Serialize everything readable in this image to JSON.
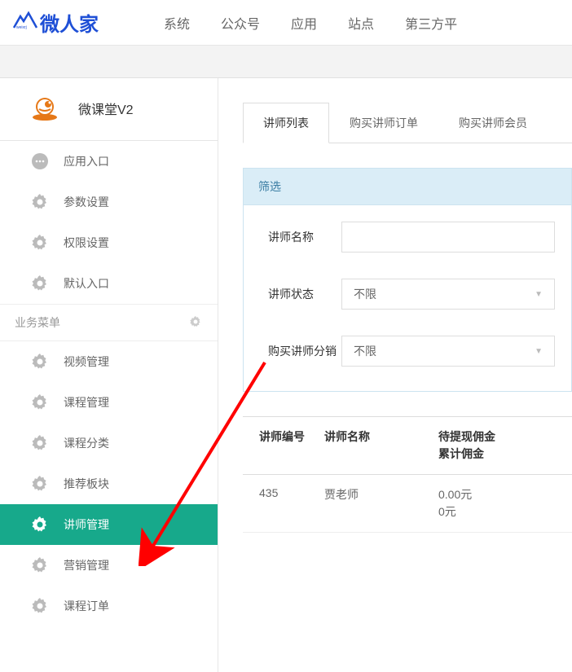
{
  "logo": "微人家",
  "topNav": {
    "items": [
      "系统",
      "公众号",
      "应用",
      "站点",
      "第三方平"
    ]
  },
  "app": {
    "title": "微课堂V2"
  },
  "sidebar": {
    "topItems": [
      {
        "label": "应用入口",
        "icon": "chat"
      },
      {
        "label": "参数设置",
        "icon": "gear"
      },
      {
        "label": "权限设置",
        "icon": "gear"
      },
      {
        "label": "默认入口",
        "icon": "gear"
      }
    ],
    "sectionLabel": "业务菜单",
    "bizItems": [
      {
        "label": "视频管理",
        "icon": "gear",
        "active": false
      },
      {
        "label": "课程管理",
        "icon": "gear",
        "active": false
      },
      {
        "label": "课程分类",
        "icon": "gear",
        "active": false
      },
      {
        "label": "推荐板块",
        "icon": "gear",
        "active": false
      },
      {
        "label": "讲师管理",
        "icon": "gear",
        "active": true
      },
      {
        "label": "营销管理",
        "icon": "gear",
        "active": false
      },
      {
        "label": "课程订单",
        "icon": "gear",
        "active": false
      }
    ]
  },
  "tabs": [
    {
      "label": "讲师列表",
      "active": true
    },
    {
      "label": "购买讲师订单",
      "active": false
    },
    {
      "label": "购买讲师会员",
      "active": false
    }
  ],
  "filter": {
    "title": "筛选",
    "fields": {
      "nameLabel": "讲师名称",
      "nameValue": "",
      "statusLabel": "讲师状态",
      "statusValue": "不限",
      "distLabel": "购买讲师分销",
      "distValue": "不限"
    }
  },
  "table": {
    "headers": {
      "col1": "讲师编号",
      "col2": "讲师名称",
      "col3": "待提现佣金\n累计佣金"
    },
    "rows": [
      {
        "col1": "435",
        "col2": "贾老师",
        "col3a": "0.00元",
        "col3b": "0元"
      }
    ]
  }
}
